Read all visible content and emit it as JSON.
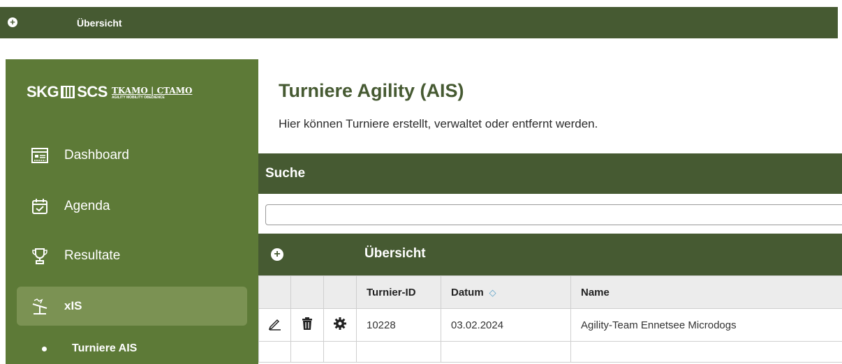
{
  "topbar": {
    "title": "Übersicht",
    "plus_icon": "plus-circle-icon"
  },
  "sidebar": {
    "logo": {
      "big_left": "SKG",
      "big_right": "SCS",
      "small_top": "TKAMO | CTAMO",
      "small_bottom": "AGILITY MOBILITY OBEDIENCE"
    },
    "items": [
      {
        "label": "Dashboard",
        "icon": "dashboard-icon"
      },
      {
        "label": "Agenda",
        "icon": "calendar-check-icon"
      },
      {
        "label": "Resultate",
        "icon": "trophy-icon"
      },
      {
        "label": "xIS",
        "icon": "agility-icon"
      }
    ],
    "sub_items": [
      {
        "label": "Turniere AIS"
      }
    ]
  },
  "main": {
    "title": "Turniere Agility (AIS)",
    "subtitle": "Hier können Turniere erstellt, verwaltet oder entfernt werden.",
    "search": {
      "heading": "Suche",
      "value": "",
      "placeholder": ""
    },
    "overview": {
      "heading": "Übersicht"
    },
    "table": {
      "headers": [
        "",
        "",
        "",
        "Turnier-ID",
        "Datum",
        "Name"
      ],
      "rows": [
        {
          "id": "10228",
          "date": "03.02.2024",
          "name": "Agility-Team Ennetsee Microdogs"
        }
      ]
    }
  }
}
